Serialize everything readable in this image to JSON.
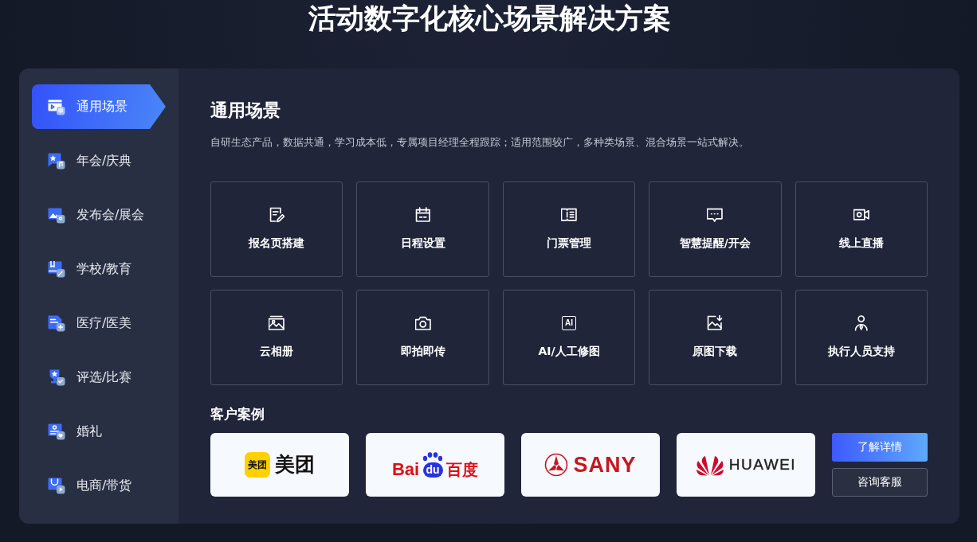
{
  "page_title": "活动数字化核心场景解决方案",
  "sidebar": {
    "items": [
      {
        "label": "通用场景",
        "selected": true
      },
      {
        "label": "年会/庆典",
        "selected": false
      },
      {
        "label": "发布会/展会",
        "selected": false
      },
      {
        "label": "学校/教育",
        "selected": false
      },
      {
        "label": "医疗/医美",
        "selected": false
      },
      {
        "label": "评选/比赛",
        "selected": false
      },
      {
        "label": "婚礼",
        "selected": false
      },
      {
        "label": "电商/带货",
        "selected": false
      }
    ]
  },
  "scene": {
    "title": "通用场景",
    "description": "自研生态产品，数据共通，学习成本低，专属项目经理全程跟踪；适用范围较广，多种类场景、混合场景一站式解决。",
    "features": [
      {
        "label": "报名页搭建"
      },
      {
        "label": "日程设置"
      },
      {
        "label": "门票管理"
      },
      {
        "label": "智慧提醒/开会"
      },
      {
        "label": "线上直播"
      },
      {
        "label": "云相册"
      },
      {
        "label": "即拍即传"
      },
      {
        "label": "AI/人工修图",
        "icon_text": "AI"
      },
      {
        "label": "原图下载"
      },
      {
        "label": "执行人员支持"
      }
    ]
  },
  "customers": {
    "title": "客户案例",
    "logos": [
      {
        "kind": "meituan",
        "badge": "美团",
        "name": "美团"
      },
      {
        "kind": "baidu",
        "prefix": "Bai",
        "badge": "du",
        "name": "百度"
      },
      {
        "kind": "sany",
        "name": "SANY"
      },
      {
        "kind": "huawei",
        "name": "HUAWEI"
      }
    ]
  },
  "buttons": [
    {
      "label": "了解详情",
      "kind": "primary"
    },
    {
      "label": "咨询客服",
      "kind": "secondary"
    }
  ]
}
